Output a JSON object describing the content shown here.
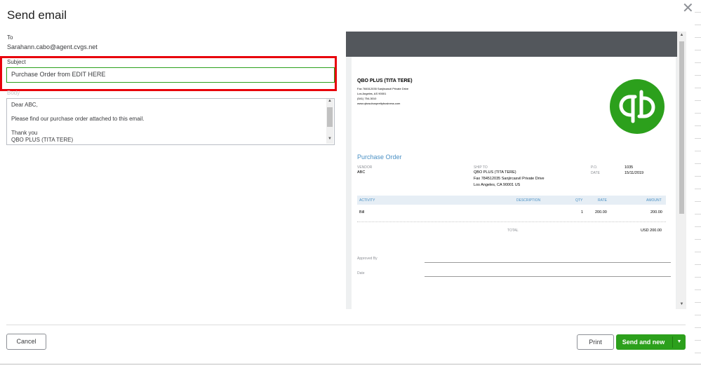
{
  "dialog": {
    "title": "Send email",
    "close_glyph": "✕"
  },
  "to": {
    "label": "To",
    "value": "Sarahann.cabo@agent.cvgs.net"
  },
  "subject": {
    "label": "Subject",
    "value": "Purchase Order from  EDIT HERE"
  },
  "body": {
    "label": "Body",
    "lines": [
      "Dear ABC,",
      "",
      "Please find our purchase order attached to this email.",
      "",
      "Thank you",
      "QBO PLUS (TITA TERE)"
    ]
  },
  "preview": {
    "company": "QBO PLUS (TITA TERE)",
    "address_lines": [
      "Fax 784512035 Sanjircasvil Private Drive",
      "Los Angeles, AS  90001",
      "(541) 754-3010",
      "www.qbosubusprettybusiness.com"
    ],
    "logo_icon": "quickbooks-logo-icon",
    "logo_text": "qb",
    "doc_title": "Purchase Order",
    "vendor_label": "VENDOR",
    "vendor_value": "ABC",
    "ship_to_label": "SHIP TO",
    "ship_to_lines": [
      "QBO PLUS (TITA TERE)",
      "Fax 784512035 Sanjircasvil Private Drive",
      "Los Angeles, CA  90001 US"
    ],
    "po_label": "P.O.",
    "po_value": "1035",
    "date_label": "DATE",
    "date_value": "15/11/2019",
    "columns": {
      "activity": "ACTIVITY",
      "description": "DESCRIPTION",
      "qty": "QTY",
      "rate": "RATE",
      "amount": "AMOUNT"
    },
    "row": {
      "activity": "Bill",
      "qty": "1",
      "rate": "200.00",
      "amount": "200.00"
    },
    "total_label": "TOTAL",
    "total_value": "USD 200.00",
    "approved_by_label": "Approved By",
    "date_sign_label": "Date"
  },
  "footer": {
    "cancel": "Cancel",
    "print": "Print",
    "send_and_new": "Send and new",
    "caret_glyph": "▼"
  },
  "colors": {
    "accent_green": "#2ca01c",
    "highlight_red": "#e8000b",
    "preview_header": "#53575c",
    "link_blue": "#4a90c4"
  }
}
